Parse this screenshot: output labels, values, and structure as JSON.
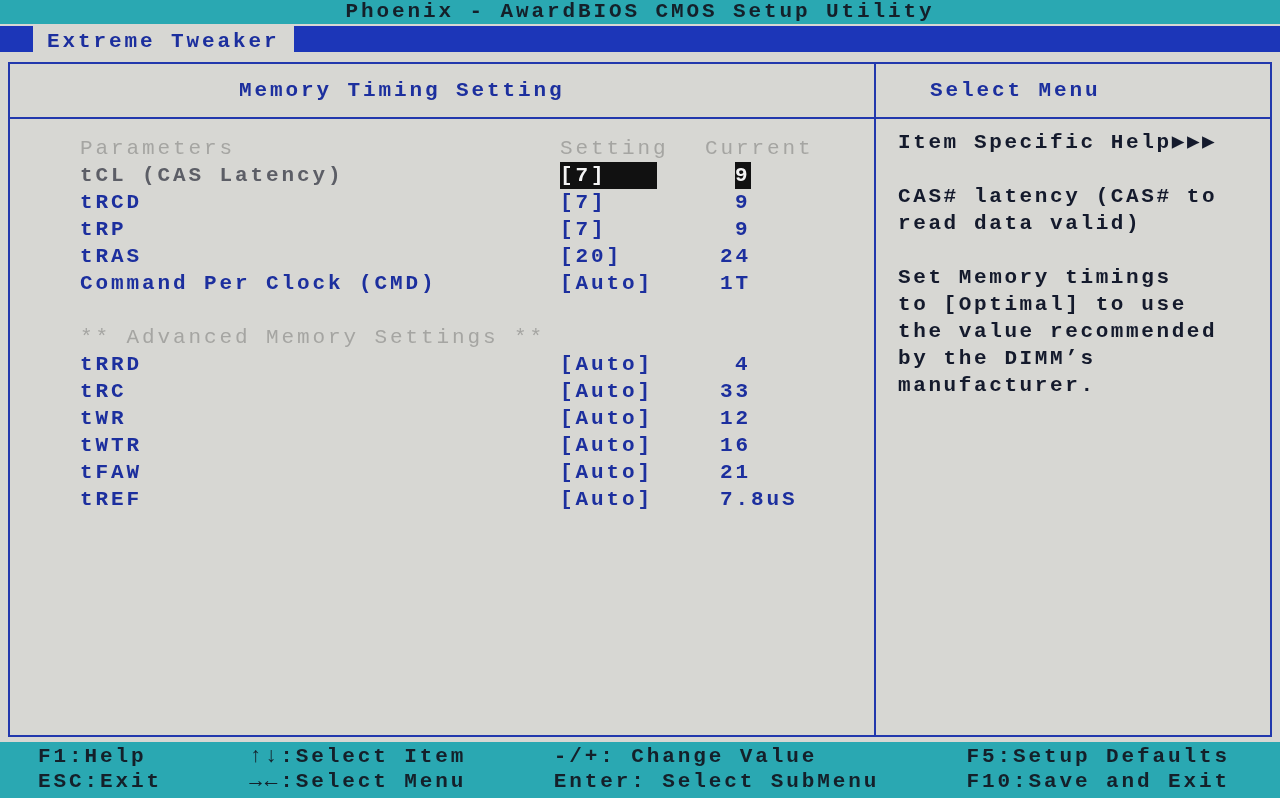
{
  "window": {
    "title": "Phoenix - AwardBIOS CMOS Setup Utility"
  },
  "tabs": [
    {
      "label": "Extreme Tweaker",
      "selected": true
    }
  ],
  "main_panel": {
    "title": "Memory Timing Setting",
    "columns": [
      "Parameters",
      "Setting",
      "Current"
    ],
    "rows": [
      {
        "kind": "item",
        "label": "tCL (CAS Latency)",
        "setting": "[7]",
        "current": "9",
        "selected": true
      },
      {
        "kind": "item",
        "label": "tRCD",
        "setting": "[7]",
        "current": "9",
        "selected": false
      },
      {
        "kind": "item",
        "label": "tRP",
        "setting": "[7]",
        "current": "9",
        "selected": false
      },
      {
        "kind": "item",
        "label": "tRAS",
        "setting": "[20]",
        "current": "24",
        "selected": false
      },
      {
        "kind": "item",
        "label": "Command Per Clock (CMD)",
        "setting": "[Auto]",
        "current": "1T",
        "selected": false
      },
      {
        "kind": "section",
        "label": "** Advanced Memory Settings **"
      },
      {
        "kind": "item",
        "label": "tRRD",
        "setting": "[Auto]",
        "current": "4",
        "selected": false
      },
      {
        "kind": "item",
        "label": "tRC",
        "setting": "[Auto]",
        "current": "33",
        "selected": false
      },
      {
        "kind": "item",
        "label": "tWR",
        "setting": "[Auto]",
        "current": "12",
        "selected": false
      },
      {
        "kind": "item",
        "label": "tWTR",
        "setting": "[Auto]",
        "current": "16",
        "selected": false
      },
      {
        "kind": "item",
        "label": "tFAW",
        "setting": "[Auto]",
        "current": "21",
        "selected": false
      },
      {
        "kind": "item",
        "label": "tREF",
        "setting": "[Auto]",
        "current": "7.8uS",
        "selected": false
      }
    ]
  },
  "help_panel": {
    "title": "Select Menu",
    "heading": "Item Specific Help▶▶▶",
    "paragraphs": [
      "CAS# latency (CAS# to\nread data valid)",
      "Set Memory timings\nto [Optimal] to use\nthe value recommended\nby the DIMM’s\nmanufacturer."
    ]
  },
  "status_bar": [
    [
      "F1:Help",
      "ESC:Exit"
    ],
    [
      "↑↓:Select Item",
      "→←:Select Menu"
    ],
    [
      "-/+: Change Value",
      "Enter: Select SubMenu"
    ],
    [
      "F5:Setup Defaults",
      "F10:Save and Exit"
    ]
  ]
}
